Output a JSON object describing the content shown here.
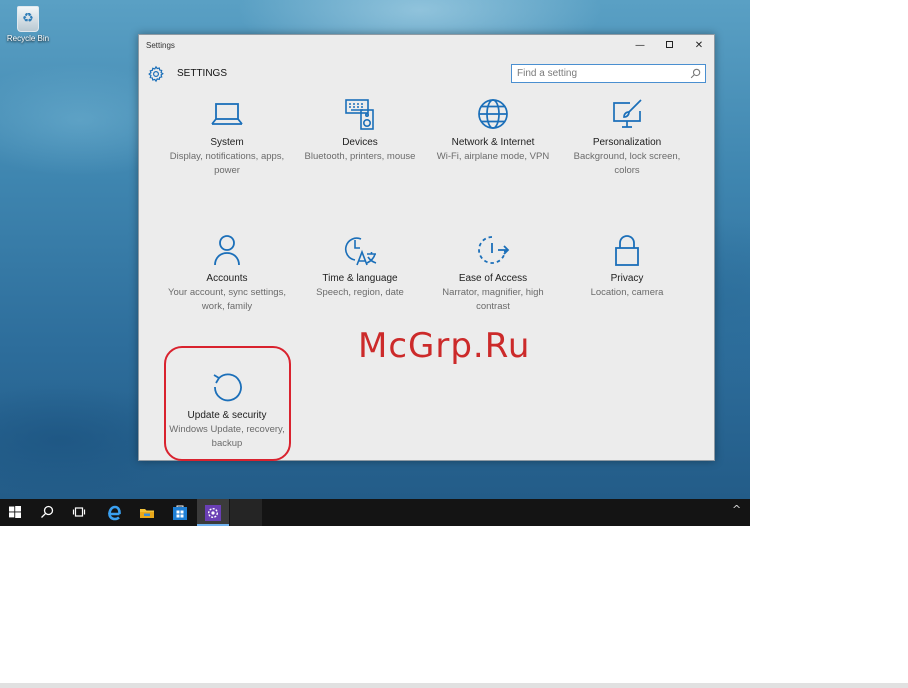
{
  "desktop": {
    "recycle_bin_label": "Recycle Bin"
  },
  "window": {
    "title": "Settings",
    "minimize_glyph": "—",
    "close_glyph": "✕"
  },
  "header": {
    "heading": "SETTINGS",
    "gear_icon": "gear-icon"
  },
  "search": {
    "placeholder": "Find a setting",
    "value": ""
  },
  "categories": [
    {
      "name": "System",
      "description": "Display, notifications, apps, power",
      "icon": "laptop-icon"
    },
    {
      "name": "Devices",
      "description": "Bluetooth, printers, mouse",
      "icon": "keyboard-speaker-icon"
    },
    {
      "name": "Network & Internet",
      "description": "Wi-Fi, airplane mode, VPN",
      "icon": "globe-icon"
    },
    {
      "name": "Personalization",
      "description": "Background, lock screen, colors",
      "icon": "paintbrush-monitor-icon"
    },
    {
      "name": "Accounts",
      "description": "Your account, sync settings, work, family",
      "icon": "person-icon"
    },
    {
      "name": "Time & language",
      "description": "Speech, region, date",
      "icon": "clock-language-icon"
    },
    {
      "name": "Ease of Access",
      "description": "Narrator, magnifier, high contrast",
      "icon": "ease-of-access-icon"
    },
    {
      "name": "Privacy",
      "description": "Location, camera",
      "icon": "padlock-icon"
    },
    {
      "name": "Update & security",
      "description": "Windows Update, recovery, backup",
      "icon": "refresh-icon"
    }
  ],
  "watermark": "McGrp.Ru",
  "colors": {
    "accent": "#1b6fb9",
    "highlight_ring": "#d9222e",
    "watermark": "#cc2a2a",
    "taskbar": "#141414"
  },
  "taskbar": {
    "items": [
      "start-icon",
      "search-icon",
      "task-view-icon",
      "edge-icon",
      "file-explorer-icon",
      "store-icon",
      "settings-icon"
    ],
    "tray_glyph": "^"
  }
}
